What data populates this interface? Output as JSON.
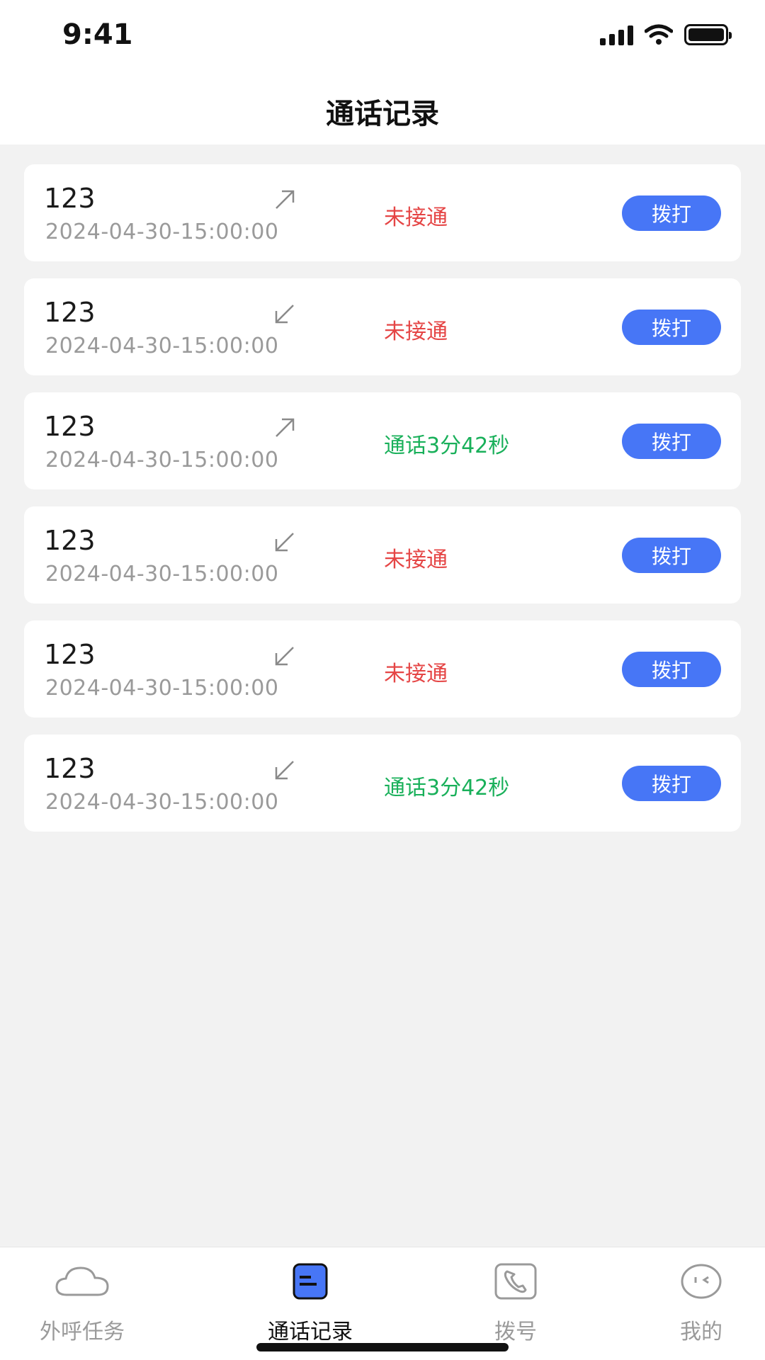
{
  "status_bar": {
    "time": "9:41",
    "icons": [
      "signal-icon",
      "wifi-icon",
      "battery-icon"
    ]
  },
  "header": {
    "title": "通话记录"
  },
  "colors": {
    "accent": "#4776F6",
    "missed": "#E54545",
    "connected": "#19B05A",
    "background": "#F2F2F2"
  },
  "records": [
    {
      "number": "123",
      "datetime": "2024-04-30-15:00:00",
      "direction": "outgoing",
      "status": "未接通",
      "status_type": "missed",
      "action": "拨打"
    },
    {
      "number": "123",
      "datetime": "2024-04-30-15:00:00",
      "direction": "incoming",
      "status": "未接通",
      "status_type": "missed",
      "action": "拨打"
    },
    {
      "number": "123",
      "datetime": "2024-04-30-15:00:00",
      "direction": "outgoing",
      "status": "通话3分42秒",
      "status_type": "connected",
      "action": "拨打"
    },
    {
      "number": "123",
      "datetime": "2024-04-30-15:00:00",
      "direction": "incoming",
      "status": "未接通",
      "status_type": "missed",
      "action": "拨打"
    },
    {
      "number": "123",
      "datetime": "2024-04-30-15:00:00",
      "direction": "incoming",
      "status": "未接通",
      "status_type": "missed",
      "action": "拨打"
    },
    {
      "number": "123",
      "datetime": "2024-04-30-15:00:00",
      "direction": "incoming",
      "status": "通话3分42秒",
      "status_type": "connected",
      "action": "拨打"
    }
  ],
  "tabbar": {
    "items": [
      {
        "label": "外呼任务",
        "icon": "cloud-icon",
        "active": false
      },
      {
        "label": "通话记录",
        "icon": "call-log-icon",
        "active": true
      },
      {
        "label": "拨号",
        "icon": "phone-icon",
        "active": false
      },
      {
        "label": "我的",
        "icon": "face-icon",
        "active": false
      }
    ]
  }
}
